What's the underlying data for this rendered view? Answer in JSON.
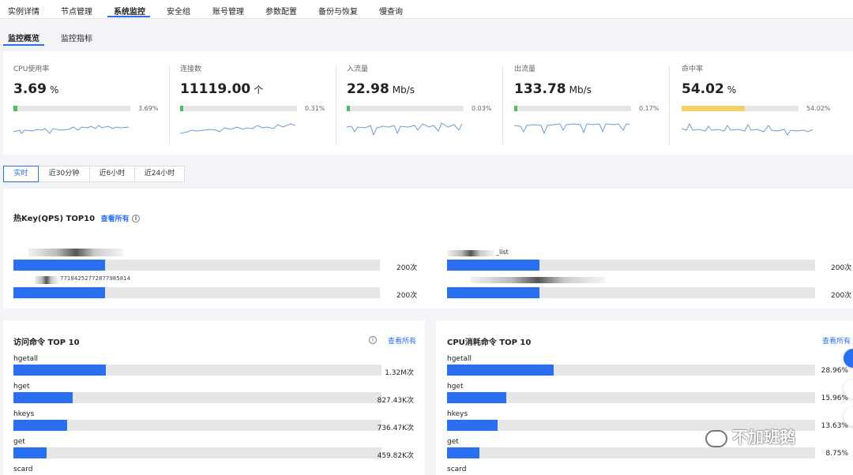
{
  "top_tabs": [
    "实例详情",
    "节点管理",
    "系统监控",
    "安全组",
    "账号管理",
    "参数配置",
    "备份与恢复",
    "慢查询"
  ],
  "sub_tabs": [
    "监控概览",
    "监控指标"
  ],
  "metrics": [
    {
      "label": "CPU使用率",
      "value": "3.69",
      "unit": "%",
      "percent_text": "3.69%",
      "fill": 0.0369,
      "color": "#4fbf5d"
    },
    {
      "label": "连接数",
      "value": "11119.00",
      "unit": "个",
      "percent_text": "0.31%",
      "fill": 0.0031,
      "color": "#4fbf5d"
    },
    {
      "label": "入流量",
      "value": "22.98",
      "unit": "Mb/s",
      "percent_text": "0.03%",
      "fill": 0.0003,
      "color": "#4fbf5d"
    },
    {
      "label": "出流量",
      "value": "133.78",
      "unit": "Mb/s",
      "percent_text": "0.17%",
      "fill": 0.0017,
      "color": "#4fbf5d"
    },
    {
      "label": "命中率",
      "value": "54.02",
      "unit": "%",
      "percent_text": "54.02%",
      "fill": 0.5402,
      "color": "#f0d16a"
    }
  ],
  "ranges": [
    "实时",
    "近30分钟",
    "近6小时",
    "近24小时"
  ],
  "hotkey": {
    "title": "热Key(QPS) TOP10",
    "link": "查看所有",
    "info_icon": "info-icon",
    "left": [
      {
        "count": "200次",
        "fill": 0.25
      },
      {
        "count": "200次",
        "fill": 0.25
      }
    ],
    "right": [
      {
        "name_fragment": "_list",
        "count": "200次",
        "fill": 0.25
      },
      {
        "count": "200次",
        "fill": 0.25
      }
    ],
    "left_fragment": "77184252772877985814"
  },
  "access": {
    "title": "访问命令 TOP 10",
    "link": "查看所有",
    "info_icon": "info-icon",
    "rows": [
      {
        "name": "hgetall",
        "value": "1.32M次",
        "fill": 0.25
      },
      {
        "name": "hget",
        "value": "827.43K次",
        "fill": 0.16
      },
      {
        "name": "hkeys",
        "value": "736.47K次",
        "fill": 0.145
      },
      {
        "name": "get",
        "value": "459.82K次",
        "fill": 0.09
      },
      {
        "name": "scard",
        "value": "",
        "fill": 0
      }
    ]
  },
  "cpu_cmd": {
    "title": "CPU消耗命令 TOP 10",
    "link": "查看所有",
    "rows": [
      {
        "name": "hgetall",
        "value": "28.96%",
        "fill": 0.29
      },
      {
        "name": "hget",
        "value": "15.96%",
        "fill": 0.16
      },
      {
        "name": "hkeys",
        "value": "13.63%",
        "fill": 0.137
      },
      {
        "name": "get",
        "value": "8.75%",
        "fill": 0.088
      },
      {
        "name": "scard",
        "value": "",
        "fill": 0
      }
    ]
  },
  "watermark": "不加班鹅",
  "accent": "#2a6ff0"
}
